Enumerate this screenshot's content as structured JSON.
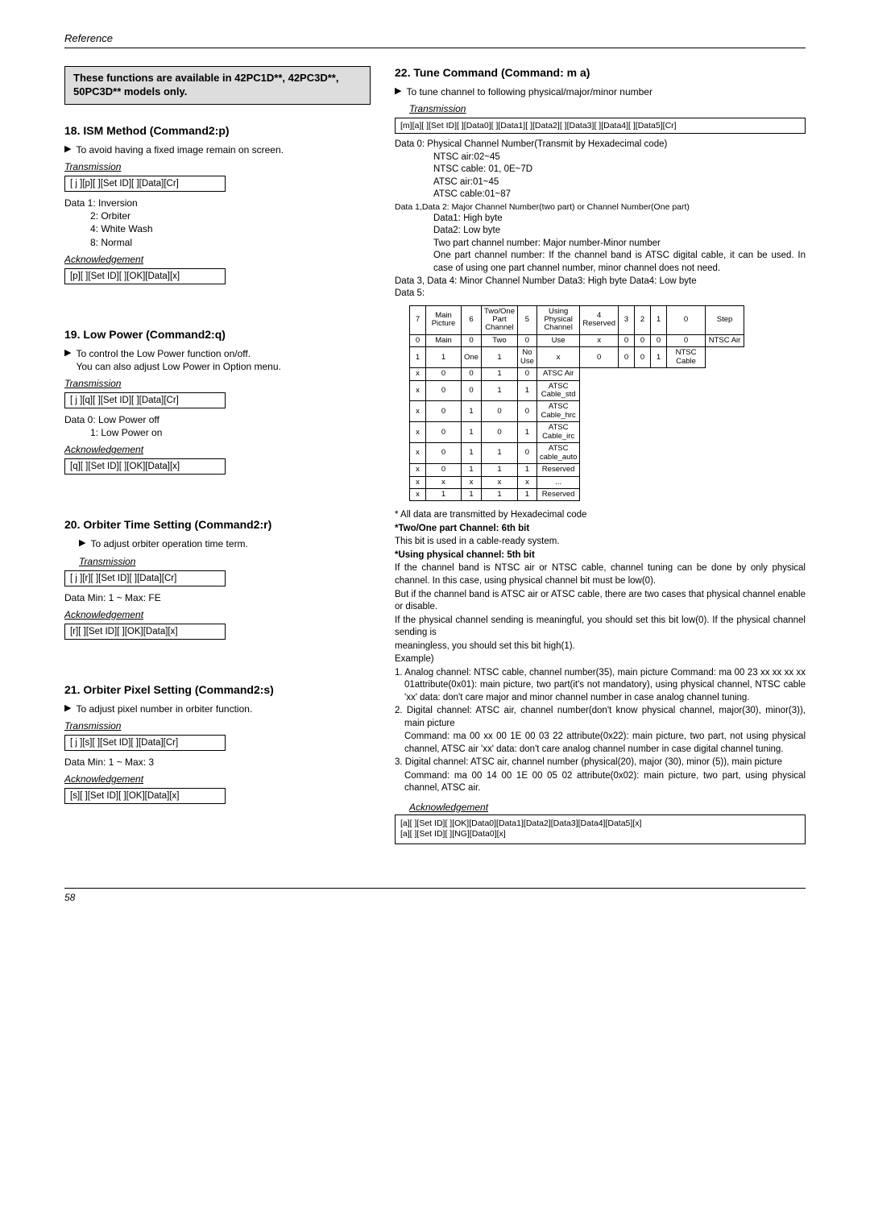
{
  "reference_label": "Reference",
  "page_number": "58",
  "notice": "These functions are available in 42PC1D**, 42PC3D**, 50PC3D** models only.",
  "s18": {
    "title": "18. ISM Method (Command2:p)",
    "desc": "To avoid having a fixed image remain on screen.",
    "trans_label": "Transmission",
    "trans_code": "[ j ][p][  ][Set ID][  ][Data][Cr]",
    "data_l1": "Data  1: Inversion",
    "data_l2": "2: Orbiter",
    "data_l3": "4: White Wash",
    "data_l4": "8: Normal",
    "ack_label": "Acknowledgement",
    "ack_code": "[p][  ][Set ID][  ][OK][Data][x]"
  },
  "s19": {
    "title": "19. Low Power (Command2:q)",
    "desc1": "To control the Low Power function on/off.",
    "desc2": "You can also adjust Low Power in Option menu.",
    "trans_label": "Transmission",
    "trans_code": "[ j ][q][  ][Set ID][  ][Data][Cr]",
    "data_l1": "Data  0: Low Power off",
    "data_l2": "1: Low Power on",
    "ack_label": "Acknowledgement",
    "ack_code": "[q][  ][Set ID][  ][OK][Data][x]"
  },
  "s20": {
    "title": "20. Orbiter Time Setting (Command2:r)",
    "desc": "To adjust orbiter operation time term.",
    "trans_label": "Transmission",
    "trans_code": "[ j ][r][  ][Set ID][  ][Data][Cr]",
    "data_l1": "Data   Min: 1 ~ Max: FE",
    "ack_label": "Acknowledgement",
    "ack_code": "[r][  ][Set ID][  ][OK][Data][x]"
  },
  "s21": {
    "title": "21. Orbiter Pixel Setting (Command2:s)",
    "desc": "To adjust pixel number in orbiter function.",
    "trans_label": "Transmission",
    "trans_code": "[ j ][s][  ][Set ID][  ][Data][Cr]",
    "data_l1": "Data   Min: 1 ~ Max: 3",
    "ack_label": "Acknowledgement",
    "ack_code": "[s][  ][Set ID][  ][OK][Data][x]"
  },
  "s22": {
    "title": "22. Tune Command (Command: m a)",
    "desc": "To tune channel to following physical/major/minor number",
    "trans_label": "Transmission",
    "trans_code": "[m][a][ ][Set ID][ ][Data0][ ][Data1][ ][Data2][ ][Data3][ ][Data4][ ][Data5][Cr]",
    "d0_l1": "Data  0: Physical Channel Number(Transmit by Hexadecimal code)",
    "d0_l2": "NTSC air:02~45",
    "d0_l3": "NTSC cable: 01, 0E~7D",
    "d0_l4": "ATSC air:01~45",
    "d0_l5": "ATSC cable:01~87",
    "d12_l1": "Data 1,Data 2: Major Channel Number(two part) or Channel Number(One part)",
    "d12_l2": "Data1: High byte",
    "d12_l3": "Data2: Low byte",
    "d12_l4": "Two part channel number: Major number-Minor number",
    "d12_l5": "One part channel number: If the channel band is ATSC digital cable, it can be used. In case of using one part channel number, minor channel does not need.",
    "d34": "Data 3, Data 4: Minor Channel Number Data3: High byte Data4: Low byte",
    "d5": "Data 5:",
    "table": {
      "row_hdr": [
        "7",
        "Main Picture",
        "6",
        "Two/One Part Channel",
        "5",
        "Using Physical Channel",
        "4 Reserved",
        "3",
        "2",
        "1",
        "0",
        "Step"
      ],
      "rows": [
        [
          "0",
          "Main",
          "0",
          "Two",
          "0",
          "Use",
          "x",
          "0",
          "0",
          "0",
          "0",
          "NTSC Air"
        ],
        [
          "1",
          "",
          "1",
          "One",
          "1",
          "No Use",
          "x",
          "0",
          "0",
          "0",
          "1",
          "NTSC Cable"
        ],
        [
          "",
          "",
          "",
          "",
          "",
          "",
          "x",
          "0",
          "0",
          "1",
          "0",
          "ATSC Air"
        ],
        [
          "",
          "",
          "",
          "",
          "",
          "",
          "x",
          "0",
          "0",
          "1",
          "1",
          "ATSC Cable_std"
        ],
        [
          "",
          "",
          "",
          "",
          "",
          "",
          "x",
          "0",
          "1",
          "0",
          "0",
          "ATSC Cable_hrc"
        ],
        [
          "",
          "",
          "",
          "",
          "",
          "",
          "x",
          "0",
          "1",
          "0",
          "1",
          "ATSC Cable_irc"
        ],
        [
          "",
          "",
          "",
          "",
          "",
          "",
          "x",
          "0",
          "1",
          "1",
          "0",
          "ATSC cable_auto"
        ],
        [
          "",
          "",
          "",
          "",
          "",
          "",
          "x",
          "0",
          "1",
          "1",
          "1",
          "Reserved"
        ],
        [
          "",
          "",
          "",
          "",
          "",
          "",
          "x",
          "x",
          "x",
          "x",
          "x",
          "..."
        ],
        [
          "",
          "",
          "",
          "",
          "",
          "",
          "x",
          "1",
          "1",
          "1",
          "1",
          "Reserved"
        ]
      ]
    },
    "notes": {
      "n1": "* All data are transmitted by Hexadecimal code",
      "n2": "*Two/One part Channel: 6th bit",
      "n3": "This bit is used in a cable-ready system.",
      "n4": "*Using physical channel: 5th bit",
      "n5": "If the channel band is NTSC air or NTSC cable, channel tuning can be done by only physical channel. In this case, using physical channel bit must be low(0).",
      "n6": "But if the channel band is ATSC air or ATSC cable, there are two cases that physical channel enable or disable.",
      "n7": "If the physical channel sending is meaningful, you should set this bit low(0). If the physical channel sending is",
      "n8": "meaningless, you should set this bit high(1).",
      "n9": "Example)",
      "n10": "1. Analog channel: NTSC cable, channel number(35), main picture Command: ma 00 23 xx xx xx xx 01attribute(0x01): main picture, two part(it's not mandatory), using physical channel, NTSC cable 'xx' data: don't care major and minor channel number in case analog channel tuning.",
      "n11": "2. Digital channel: ATSC air, channel number(don't know physical channel, major(30), minor(3)), main picture",
      "n11b": "Command: ma 00 xx 00 1E 00 03 22 attribute(0x22): main picture, two part, not using physical channel, ATSC air 'xx' data: don't care analog channel number in case digital channel tuning.",
      "n12": "3. Digital channel: ATSC air, channel number (physical(20), major (30), minor (5)), main picture",
      "n12b": "Command: ma 00 14 00 1E 00 05 02 attribute(0x02): main picture, two part, using physical channel, ATSC air."
    },
    "ack_label": "Acknowledgement",
    "ack_l1": "[a][  ][Set ID][  ][OK][Data0][Data1][Data2][Data3][Data4][Data5][x]",
    "ack_l2": "[a][  ][Set ID][  ][NG][Data0][x]"
  }
}
